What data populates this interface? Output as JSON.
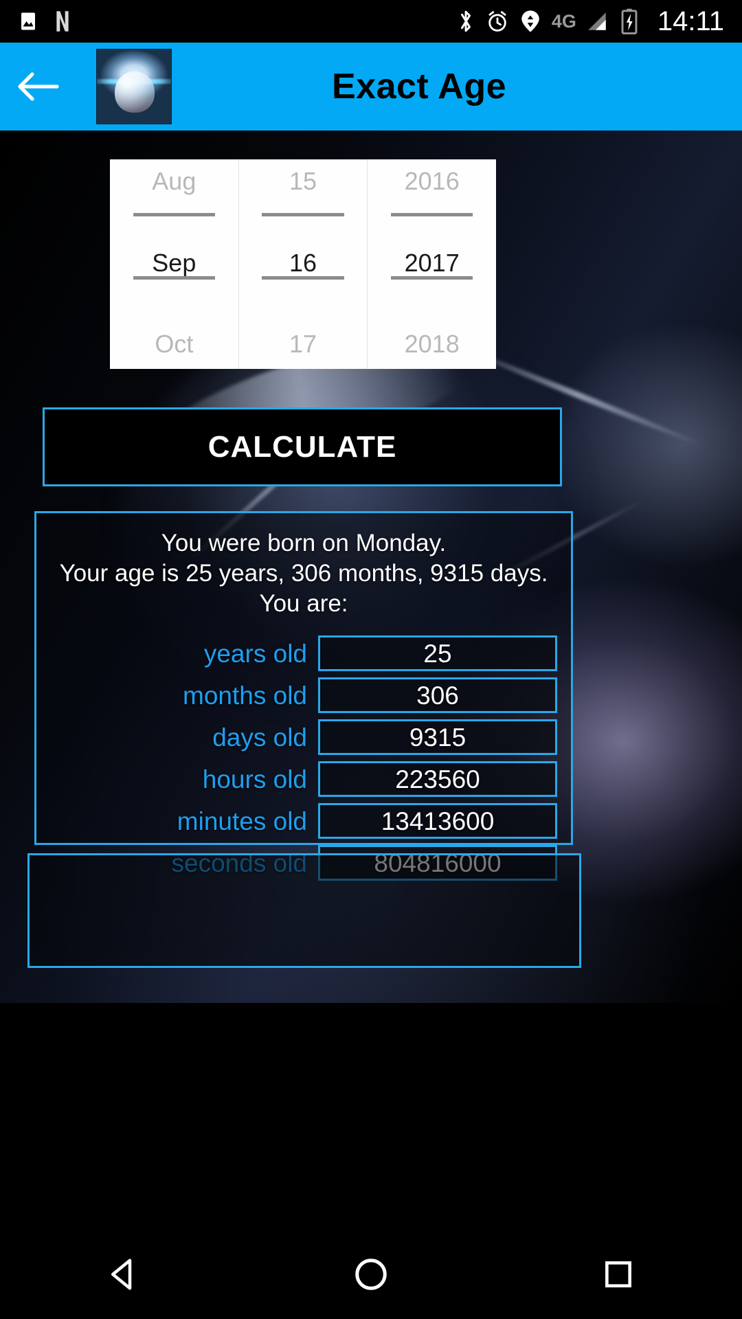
{
  "status_bar": {
    "time": "14:11",
    "network_label": "4G",
    "icons": [
      "image-icon",
      "netflix-n-icon",
      "bluetooth-icon",
      "alarm-icon",
      "location-icon",
      "signal-icon",
      "battery-charging-icon"
    ]
  },
  "app_bar": {
    "title": "Exact Age",
    "back_icon": "back-arrow-icon",
    "logo_icon": "app-logo-face-icon"
  },
  "date_picker": {
    "month": {
      "previous": "Aug",
      "current": "Sep",
      "next": "Oct"
    },
    "day": {
      "previous": "15",
      "current": "16",
      "next": "17"
    },
    "year": {
      "previous": "2016",
      "current": "2017",
      "next": "2018"
    }
  },
  "calculate_button": {
    "label": "CALCULATE"
  },
  "result": {
    "summary_line1": "You were born on Monday.",
    "summary_line2": "Your age is 25 years, 306 months, 9315 days.",
    "summary_line3": "You are:",
    "rows": [
      {
        "label": "years old",
        "value": "25"
      },
      {
        "label": "months old",
        "value": "306"
      },
      {
        "label": "days old",
        "value": "9315"
      },
      {
        "label": "hours old",
        "value": "223560"
      },
      {
        "label": "minutes old",
        "value": "13413600"
      },
      {
        "label": "seconds old",
        "value": "804816000"
      }
    ]
  },
  "ad_box": {
    "content": ""
  },
  "nav_bar": {
    "back_icon": "triangle-back-icon",
    "home_icon": "circle-home-icon",
    "recents_icon": "square-recents-icon"
  },
  "colors": {
    "accent": "#03A9F4",
    "border": "#2aa8e8",
    "label": "#1e9ff0",
    "picker_bg": "#fefefe",
    "picker_dim": "#b8b8b8"
  }
}
